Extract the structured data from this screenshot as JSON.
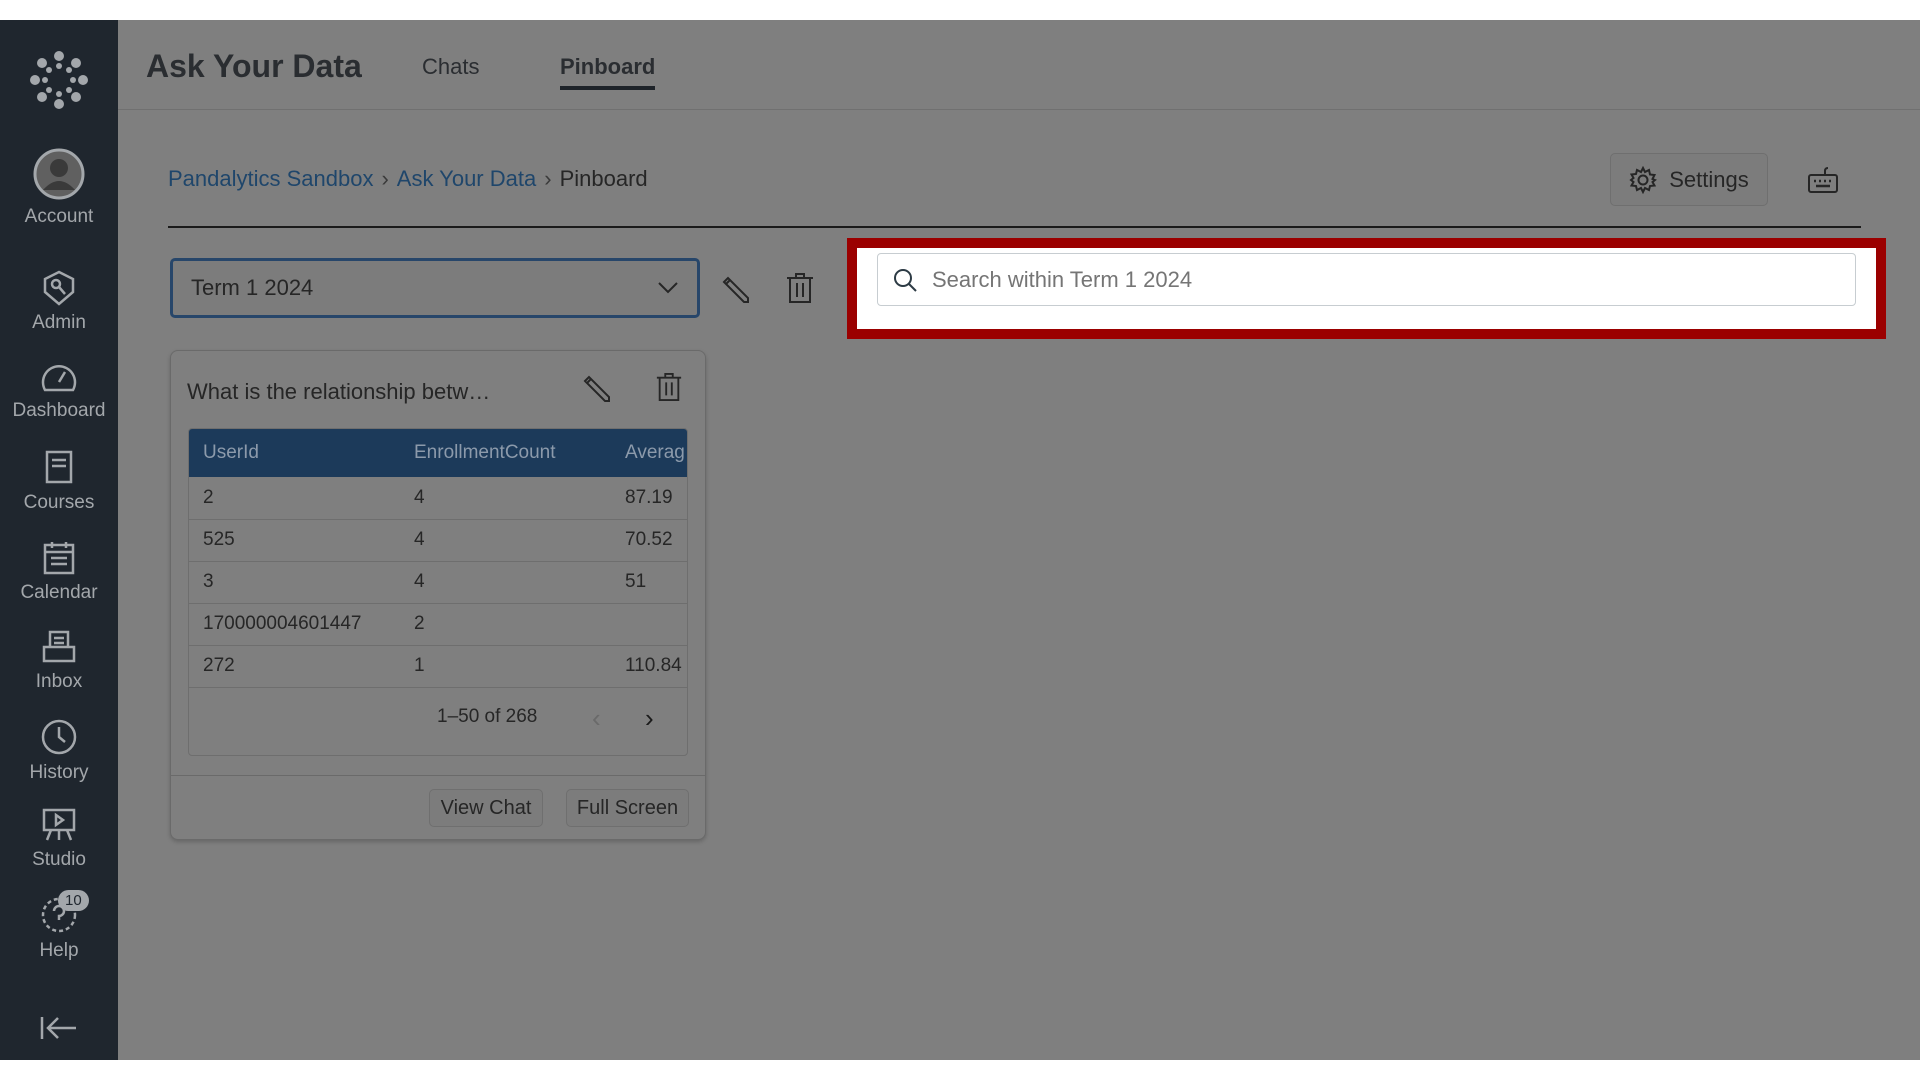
{
  "sidebar": {
    "items": [
      {
        "label": "Account",
        "icon": "account-icon"
      },
      {
        "label": "Admin",
        "icon": "admin-icon"
      },
      {
        "label": "Dashboard",
        "icon": "dashboard-icon"
      },
      {
        "label": "Courses",
        "icon": "courses-icon"
      },
      {
        "label": "Calendar",
        "icon": "calendar-icon"
      },
      {
        "label": "Inbox",
        "icon": "inbox-icon"
      },
      {
        "label": "History",
        "icon": "history-icon"
      },
      {
        "label": "Studio",
        "icon": "studio-icon"
      },
      {
        "label": "Help",
        "icon": "help-icon",
        "badge": "10"
      }
    ]
  },
  "header": {
    "title": "Ask Your Data",
    "tabs": [
      {
        "label": "Chats"
      },
      {
        "label": "Pinboard",
        "active": true
      }
    ]
  },
  "breadcrumb": [
    "Pandalytics Sandbox",
    "Ask Your Data",
    "Pinboard"
  ],
  "settings_label": "Settings",
  "pinboard_select": "Term 1 2024",
  "search": {
    "placeholder": "Search within Term 1 2024",
    "value": ""
  },
  "card": {
    "title": "What is the relationship betw…",
    "columns": [
      "UserId",
      "EnrollmentCount",
      "Averag"
    ],
    "rows": [
      [
        "2",
        "4",
        "87.19"
      ],
      [
        "525",
        "4",
        "70.52"
      ],
      [
        "3",
        "4",
        "51"
      ],
      [
        "170000004601447",
        "2",
        ""
      ],
      [
        "272",
        "1",
        "110.84"
      ]
    ],
    "pagination": "1–50 of 268",
    "view_chat": "View Chat",
    "full_screen": "Full Screen"
  },
  "colors": {
    "highlight": "#9b0000",
    "sidebar": "#1f262e",
    "table_header": "#1c3a5a"
  }
}
